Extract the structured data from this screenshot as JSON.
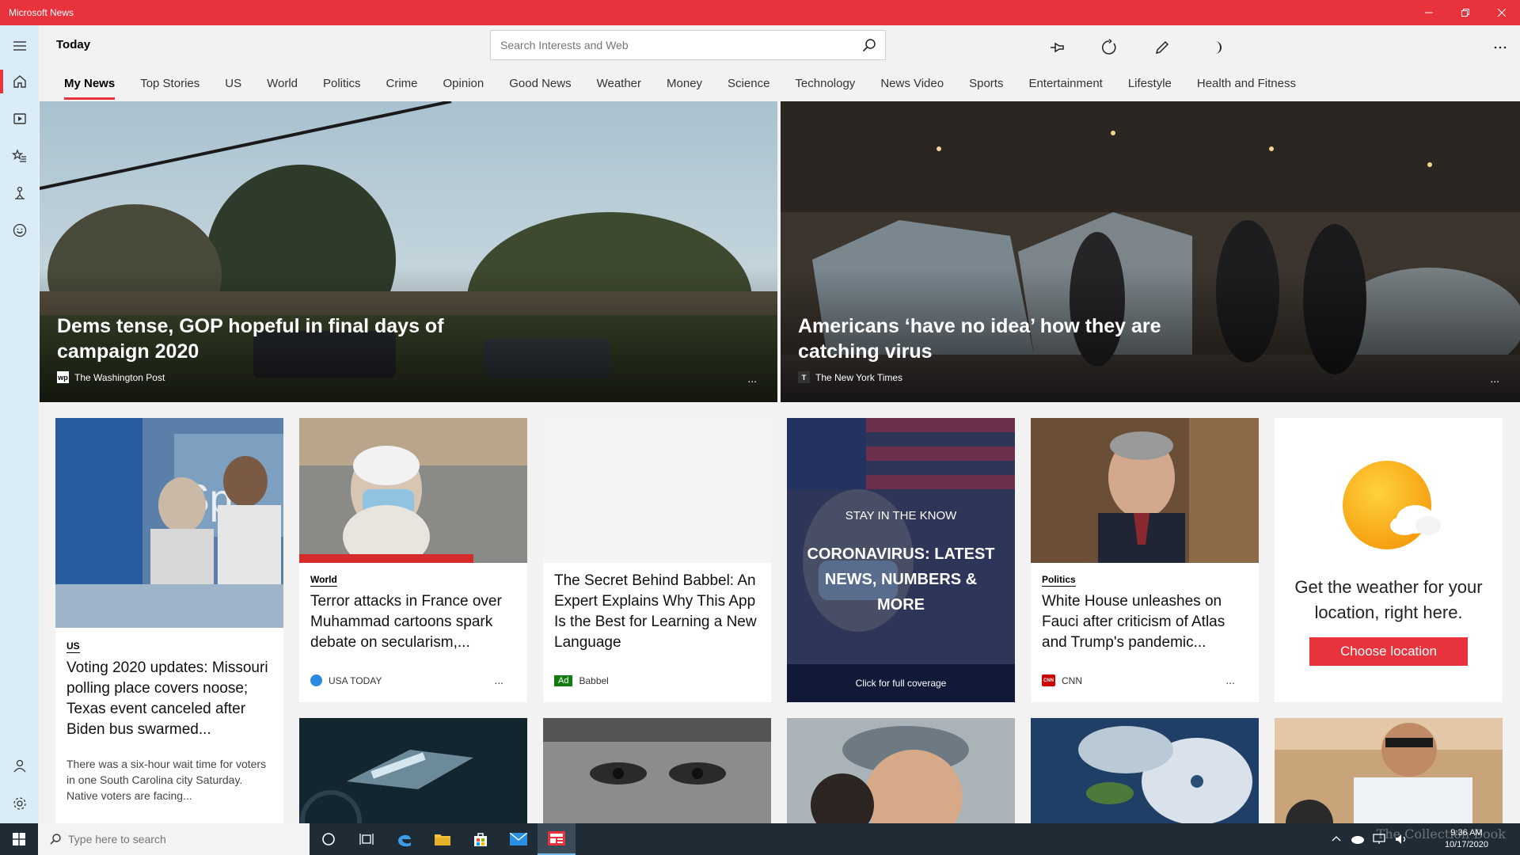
{
  "window": {
    "title": "Microsoft News"
  },
  "header": {
    "title": "Today",
    "search_placeholder": "Search Interests and Web"
  },
  "tabs": [
    {
      "label": "My News",
      "active": true
    },
    {
      "label": "Top Stories"
    },
    {
      "label": "US"
    },
    {
      "label": "World"
    },
    {
      "label": "Politics"
    },
    {
      "label": "Crime"
    },
    {
      "label": "Opinion"
    },
    {
      "label": "Good News"
    },
    {
      "label": "Weather"
    },
    {
      "label": "Money"
    },
    {
      "label": "Science"
    },
    {
      "label": "Technology"
    },
    {
      "label": "News Video"
    },
    {
      "label": "Sports"
    },
    {
      "label": "Entertainment"
    },
    {
      "label": "Lifestyle"
    },
    {
      "label": "Health and Fitness"
    }
  ],
  "hero": [
    {
      "title": "Dems tense, GOP hopeful in final days of campaign 2020",
      "source": "The Washington Post",
      "logo": "wp",
      "more": "..."
    },
    {
      "title": "Americans ‘have no idea’ how they are catching virus",
      "source": "The New York Times",
      "logo": "T",
      "more": "..."
    }
  ],
  "cards": {
    "voting": {
      "category": "US",
      "title": "Voting 2020 updates: Missouri polling place covers noose; Texas event canceled after Biden bus swarmed...",
      "excerpt": "There was a six-hour wait time for voters in one South Carolina city Saturday. Native voters are facing..."
    },
    "france": {
      "category": "World",
      "title": "Terror attacks in France over Muhammad cartoons spark debate on secularism,...",
      "source": "USA TODAY",
      "more": "..."
    },
    "babbel": {
      "title": "The Secret Behind Babbel: An Expert Explains Why This App Is the Best for Learning a New Language",
      "ad_label": "Ad",
      "source": "Babbel"
    },
    "covid": {
      "kicker": "STAY IN THE KNOW",
      "title": "CORONAVIRUS: LATEST NEWS, NUMBERS & MORE",
      "cta": "Click for full coverage"
    },
    "fauci": {
      "category": "Politics",
      "title": "White House unleashes on Fauci after criticism of Atlas and Trump's pandemic...",
      "source": "CNN",
      "logo": "CNN",
      "more": "..."
    },
    "weather": {
      "text": "Get the weather for your location, right here.",
      "button": "Choose location"
    }
  },
  "taskbar": {
    "search_placeholder": "Type here to search",
    "time": "9:36 AM",
    "date": "10/17/2020"
  },
  "watermark": "The Collection Book",
  "colors": {
    "accent": "#e8323c",
    "rail": "#d9ecf7",
    "taskbar": "#1f2b35"
  }
}
